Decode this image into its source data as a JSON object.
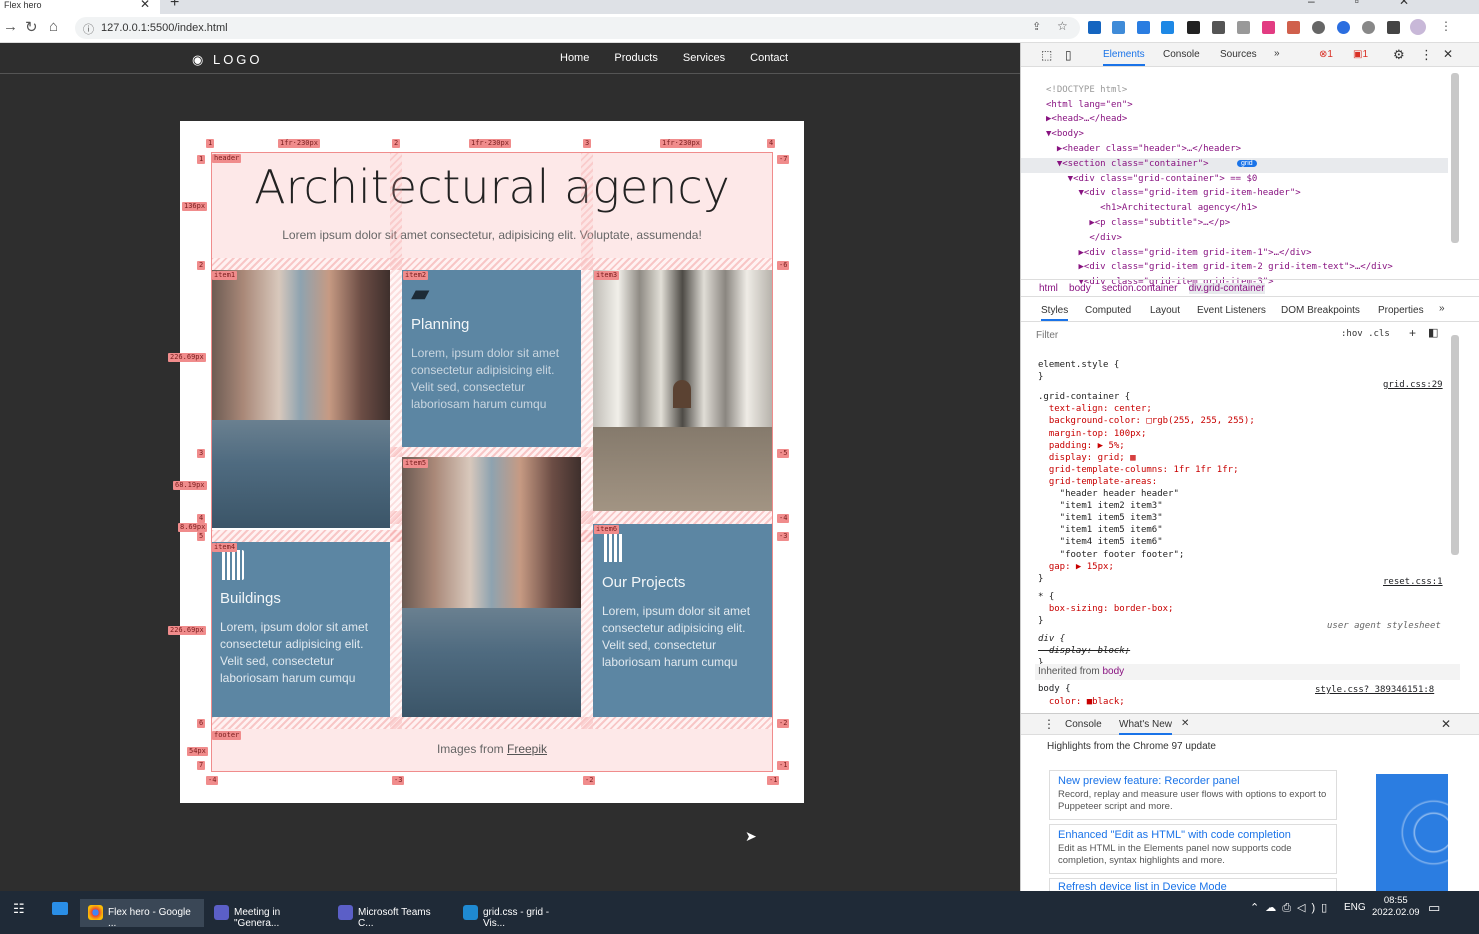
{
  "browser": {
    "tab_title": "Flex hero",
    "url": "127.0.0.1:5500/index.html"
  },
  "site": {
    "logo": "LOGO",
    "nav": [
      "Home",
      "Products",
      "Services",
      "Contact"
    ],
    "title": "Architectural agency",
    "subtitle": "Lorem ipsum dolor sit amet consectetur, adipisicing elit. Voluptate, assumenda!",
    "cards": [
      {
        "title": "Planning",
        "text": "Lorem, ipsum dolor sit amet consectetur adipisicing elit. Velit sed, consectetur laboriosam harum cumqu"
      },
      {
        "title": "Buildings",
        "text": "Lorem, ipsum dolor sit amet consectetur adipisicing elit. Velit sed, consectetur laboriosam harum cumqu"
      },
      {
        "title": "Our Projects",
        "text": "Lorem, ipsum dolor sit amet consectetur adipisicing elit. Velit sed, consectetur laboriosam harum cumqu"
      }
    ],
    "footer_prefix": "Images from",
    "footer_link": "Freepik"
  },
  "grid_overlay": {
    "col_numbers": [
      "1",
      "2",
      "3",
      "4"
    ],
    "col_sizes": [
      "1fr·230px",
      "1fr·230px",
      "1fr·230px"
    ],
    "row_numbers_left": [
      "1",
      "2",
      "3",
      "4",
      "5",
      "6",
      "7"
    ],
    "row_sizes": [
      "136px",
      "226.69px",
      "68.19px",
      "8.69px",
      "226.69px",
      "54px"
    ],
    "row_numbers_right": [
      "-7",
      "-6",
      "-5",
      "-4",
      "-3",
      "-2",
      "-1"
    ],
    "bottom_numbers": [
      "-4",
      "-3",
      "-2",
      "-1"
    ],
    "area_names": [
      "header",
      "item1",
      "item2",
      "item3",
      "item5",
      "item6",
      "item4",
      "footer"
    ]
  },
  "devtools": {
    "tabs": [
      "Elements",
      "Console",
      "Sources"
    ],
    "errors": "1",
    "issues": "1",
    "dom": [
      "<!DOCTYPE html>",
      "<html lang=\"en\">",
      "▶<head>…</head>",
      "▼<body>",
      "  ▶<header class=\"header\">…</header>",
      "  ▼<section class=\"container\">",
      "    ▼<div class=\"grid-container\"> == $0",
      "      ▼<div class=\"grid-item grid-item-header\">",
      "          <h1>Architectural agency</h1>",
      "        ▶<p class=\"subtitle\">…</p>",
      "        </div>",
      "      ▶<div class=\"grid-item grid-item-1\">…</div>",
      "      ▶<div class=\"grid-item grid-item-2 grid-item-text\">…</div>",
      "      ▼<div class=\"grid-item grid-item-3\">"
    ],
    "grid_badge": "grid",
    "breadcrumbs": [
      "html",
      "body",
      "section.container",
      "div.grid-container"
    ],
    "subtabs": [
      "Styles",
      "Computed",
      "Layout",
      "Event Listeners",
      "DOM Breakpoints",
      "Properties"
    ],
    "filter_placeholder": "Filter",
    "filter_buttons": ":hov  .cls",
    "styles": [
      "element.style {",
      "}",
      ".grid-container {",
      "  text-align: center;",
      "  background-color: □rgb(255, 255, 255);",
      "  margin-top: 100px;",
      "  padding: ▶ 5%;",
      "  display: grid; ▦",
      "  grid-template-columns: 1fr 1fr 1fr;",
      "  grid-template-areas:",
      "    \"header header header\"",
      "    \"item1 item2 item3\"",
      "    \"item1 item5 item3\"",
      "    \"item1 item5 item6\"",
      "    \"item4 item5 item6\"",
      "    \"footer footer footer\";",
      "  gap: ▶ 15px;",
      "}"
    ],
    "source1": "grid.css:29",
    "reset_rule": [
      "* {",
      "  box-sizing: border-box;",
      "}"
    ],
    "source2": "reset.css:1",
    "ua_rule": [
      "div {",
      "  display: block;",
      "}"
    ],
    "source3": "user agent stylesheet",
    "inherited": "Inherited from",
    "inherited_from": "body",
    "body_rule": [
      "body {",
      "  color: ■black;"
    ],
    "source4": "style.css?_389346151:8",
    "drawer_tabs": [
      "Console",
      "What's New"
    ],
    "whatsnew_heading": "Highlights from the Chrome 97 update",
    "news": [
      {
        "title": "New preview feature: Recorder panel",
        "text": "Record, replay and measure user flows with options to export to Puppeteer script and more."
      },
      {
        "title": "Enhanced \"Edit as HTML\" with code completion",
        "text": "Edit as HTML in the Elements panel now supports code completion, syntax highlights and more."
      },
      {
        "title": "Refresh device list in Device Mode",
        "text": ""
      }
    ]
  },
  "taskbar": {
    "items": [
      "Flex hero - Google ...",
      "Meeting in \"Genera...",
      "Microsoft Teams C...",
      "grid.css - grid - Vis..."
    ],
    "lang": "ENG",
    "time": "08:55",
    "date": "2022.02.09"
  }
}
